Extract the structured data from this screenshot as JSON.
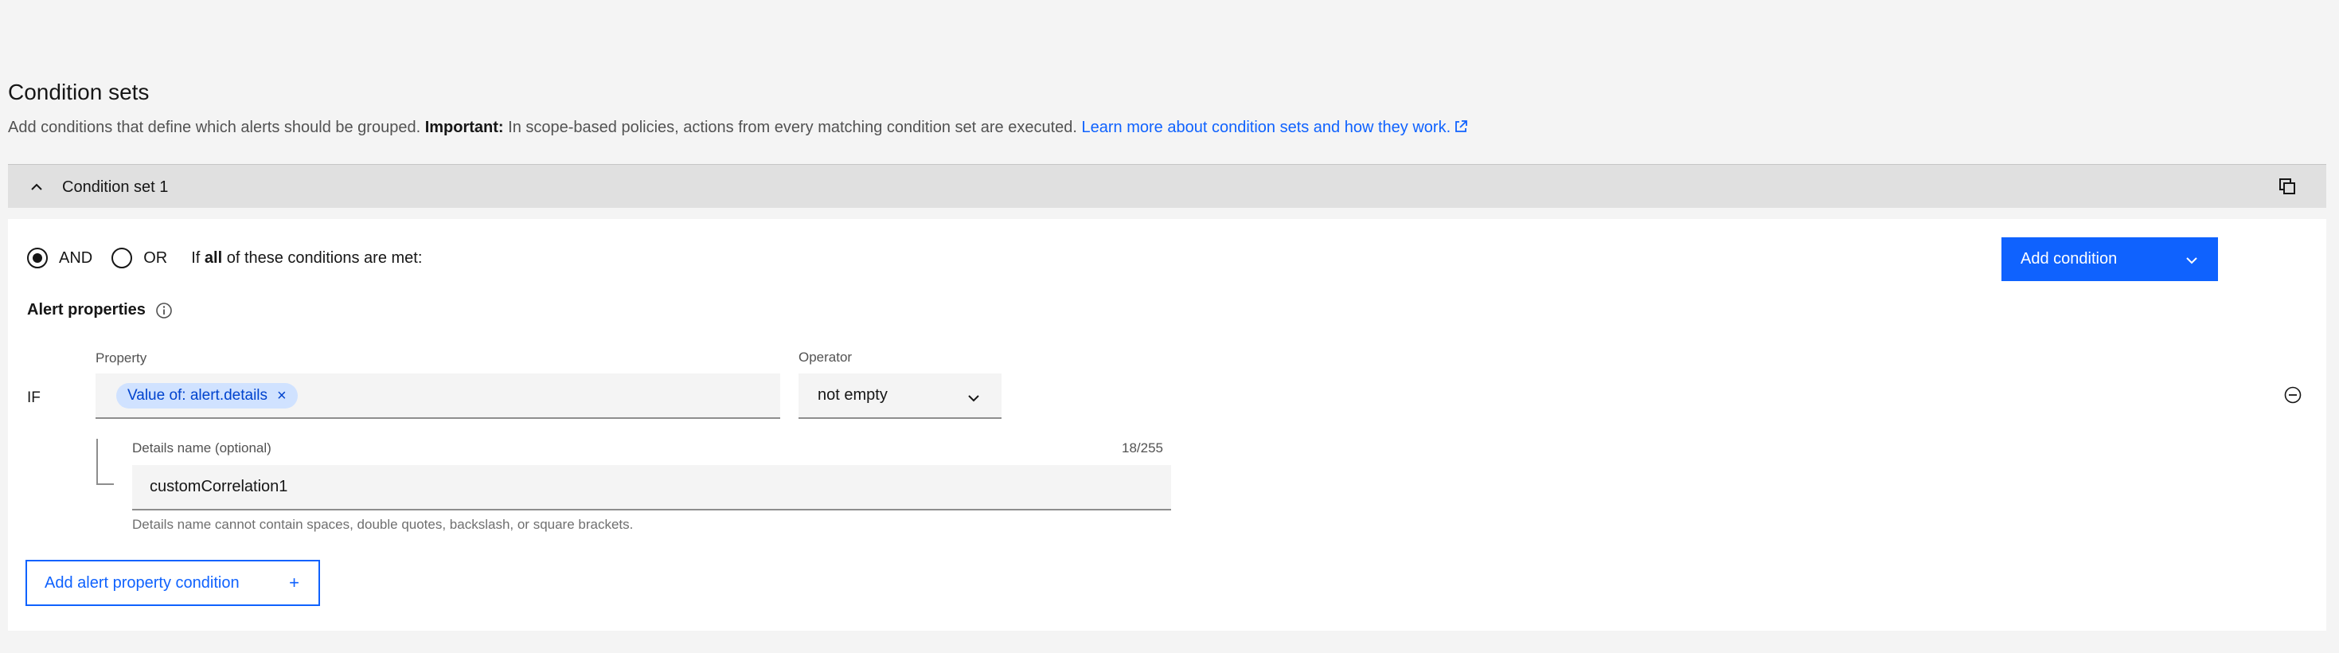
{
  "section": {
    "title": "Condition sets",
    "description_prefix": "Add conditions that define which alerts should be grouped. ",
    "description_important": "Important:",
    "description_middle": " In scope-based policies, actions from every matching condition set are executed. ",
    "link_text": "Learn more about condition sets and how they work."
  },
  "condition_set": {
    "title": "Condition set 1",
    "logic": {
      "and_label": "AND",
      "or_label": "OR",
      "selected": "AND",
      "text_prefix": "If ",
      "text_bold": "all",
      "text_suffix": " of these conditions are met:"
    },
    "add_condition_label": "Add condition",
    "alert_properties_label": "Alert properties",
    "condition": {
      "if_label": "IF",
      "property_label": "Property",
      "property_tag": "Value of: alert.details",
      "tag_remove": "×",
      "operator_label": "Operator",
      "operator_value": "not empty"
    },
    "details": {
      "label": "Details name (optional)",
      "count": "18/255",
      "value": "customCorrelation1",
      "helper": "Details name cannot contain spaces, double quotes, backslash, or square brackets."
    },
    "add_property_label": "Add alert property condition",
    "add_property_icon": "+"
  },
  "colors": {
    "primary": "#0f62fe",
    "tag_bg": "#d0e2ff",
    "tag_text": "#0043ce",
    "page_bg": "#f4f4f4",
    "accordion_bg": "#e0e0e0"
  },
  "icons": [
    "external-link-icon",
    "chevron-up-icon",
    "copy-icon",
    "chevron-down-icon",
    "information-icon",
    "close-icon",
    "subtract-circle-icon",
    "add-icon"
  ]
}
